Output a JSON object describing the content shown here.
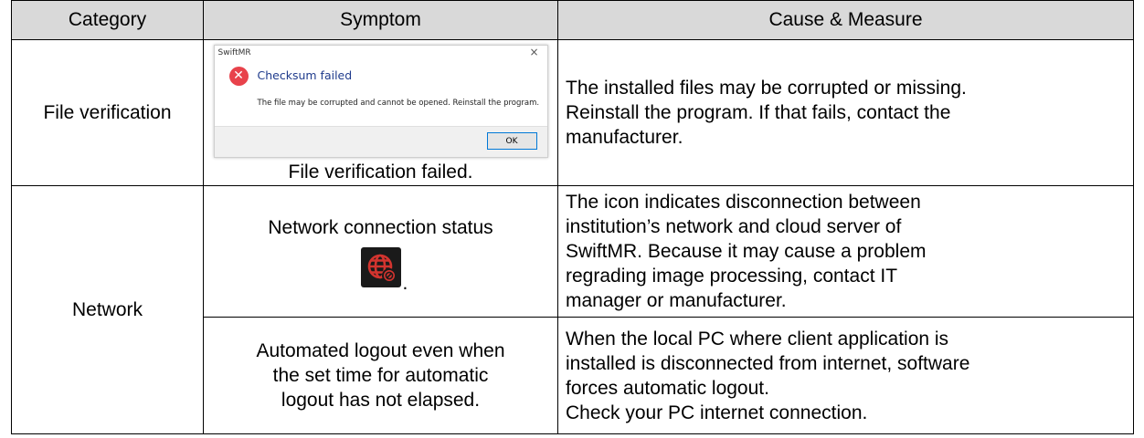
{
  "headers": {
    "category": "Category",
    "symptom": "Symptom",
    "cause": "Cause & Measure"
  },
  "rows": [
    {
      "category": "File verification",
      "dialog": {
        "window_title": "SwiftMR",
        "close_glyph": "×",
        "heading": "Checksum failed",
        "message": "The file may be corrupted and cannot be opened. Reinstall the program.",
        "ok_label": "OK",
        "icon": "error-icon",
        "icon_color": "#e8424b"
      },
      "symptom_caption": "File verification failed.",
      "cause_lines": [
        "The installed files may be corrupted or missing.",
        "Reinstall the program. If that fails, contact the",
        "manufacturer."
      ]
    },
    {
      "category": "Network",
      "symptom_title": "Network connection status",
      "symptom_trailing": ".",
      "icon": "network-disconnected-icon",
      "icon_colors": {
        "background": "#1a1a1a",
        "globe": "#d3342f"
      },
      "cause_lines": [
        "The icon indicates disconnection between",
        "institution’s network and cloud server of",
        "SwiftMR. Because it may cause a problem",
        "regrading image processing, contact IT",
        "manager or manufacturer."
      ]
    },
    {
      "symptom_lines": [
        "Automated logout even when",
        "the set time for automatic",
        "logout has not elapsed."
      ],
      "cause_lines": [
        "When the local PC where client application is",
        "installed is disconnected from internet, software",
        "forces automatic logout.",
        "Check your PC internet connection."
      ]
    }
  ]
}
